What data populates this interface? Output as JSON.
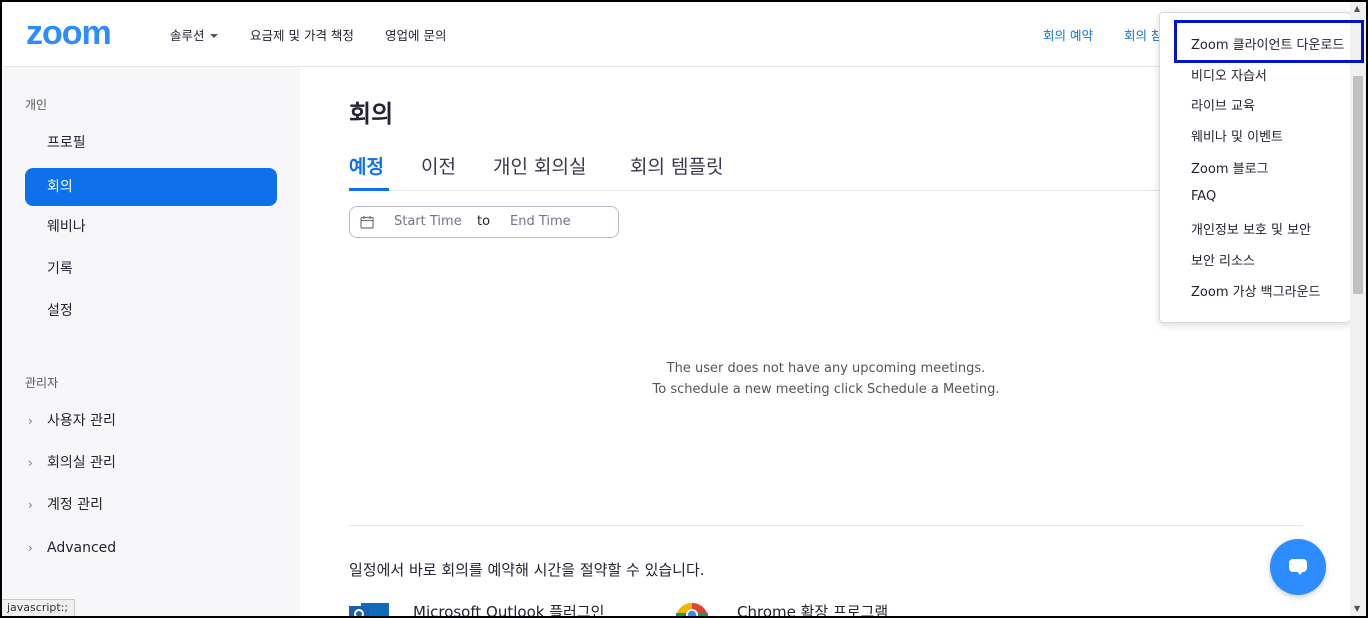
{
  "header": {
    "logo": "zoom",
    "nav": {
      "solutions": "솔루션",
      "pricing": "요금제 및 가격 책정",
      "sales": "영업에 문의"
    },
    "right": {
      "schedule": "회의 예약",
      "join": "회의 참"
    }
  },
  "sidebar": {
    "personal_title": "개인",
    "items": [
      {
        "label": "프로필",
        "active": false
      },
      {
        "label": "회의",
        "active": true
      },
      {
        "label": "웨비나",
        "active": false
      },
      {
        "label": "기록",
        "active": false
      },
      {
        "label": "설정",
        "active": false
      }
    ],
    "admin_title": "관리자",
    "admin_items": [
      {
        "label": "사용자 관리"
      },
      {
        "label": "회의실 관리"
      },
      {
        "label": "계정 관리"
      },
      {
        "label": "Advanced"
      }
    ]
  },
  "main": {
    "title": "회의",
    "tabs": [
      {
        "label": "예정",
        "active": true
      },
      {
        "label": "이전",
        "active": false
      },
      {
        "label": "개인 회의실",
        "active": false
      },
      {
        "label": "회의 템플릿",
        "active": false
      }
    ],
    "date_range": {
      "start": "Start Time",
      "separator": "to",
      "end": "End Time"
    },
    "empty_line1": "The user does not have any upcoming meetings.",
    "empty_line2": "To schedule a new meeting click Schedule a Meeting.",
    "promo": "일정에서 바로 회의를 예약해 시간을 절약할 수 있습니다.",
    "integrations": {
      "outlook": "Microsoft Outlook 플러그인",
      "chrome": "Chrome 확장 프로그램"
    }
  },
  "dropdown": {
    "items": [
      "Zoom 클라이언트 다운로드",
      "비디오 자습서",
      "라이브 교육",
      "웨비나 및 이벤트",
      "Zoom 블로그",
      "FAQ",
      "개인정보 보호 및 보안",
      "보안 리소스",
      "Zoom 가상 백그라운드"
    ]
  },
  "statusbar": {
    "text": "javascript:;"
  },
  "colors": {
    "brand": "#2d8cff",
    "accent": "#0e71eb",
    "highlight": "#0016c8"
  },
  "icons": {
    "calendar": "calendar-icon",
    "chat": "chat-icon",
    "outlook": "outlook-icon",
    "chrome": "chrome-icon"
  }
}
